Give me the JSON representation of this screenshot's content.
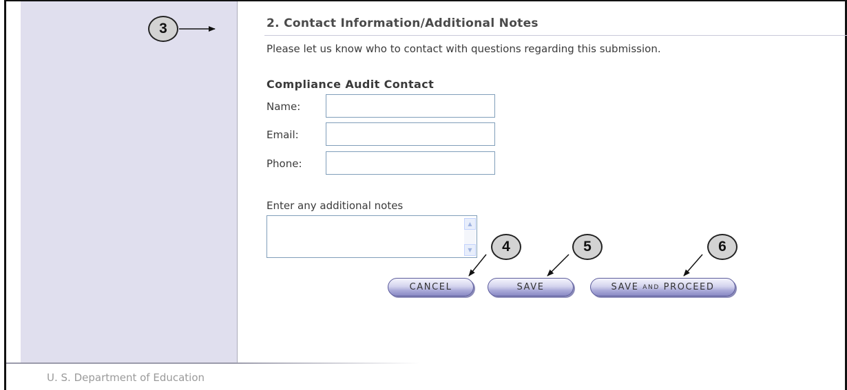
{
  "section": {
    "title": "2. Contact Information/Additional Notes",
    "intro": "Please let us know who to contact with questions regarding this submission."
  },
  "contact": {
    "heading": "Compliance Audit Contact",
    "fields": [
      {
        "label": "Name:",
        "value": ""
      },
      {
        "label": "Email:",
        "value": ""
      },
      {
        "label": "Phone:",
        "value": ""
      }
    ]
  },
  "notes": {
    "label": "Enter any additional notes",
    "value": ""
  },
  "buttons": {
    "cancel": "CANCEL",
    "save": "SAVE",
    "save_proceed_a": "SAVE ",
    "save_proceed_b": "AND",
    "save_proceed_c": " PROCEED"
  },
  "callouts": [
    "3",
    "4",
    "5",
    "6"
  ],
  "footer": {
    "text": "U. S. Department of Education"
  },
  "colors": {
    "sidebar": "#e0dfee",
    "button_fill": "#b8b8e0",
    "input_border": "#7f9db9",
    "callout_fill": "#d3d3d3"
  }
}
